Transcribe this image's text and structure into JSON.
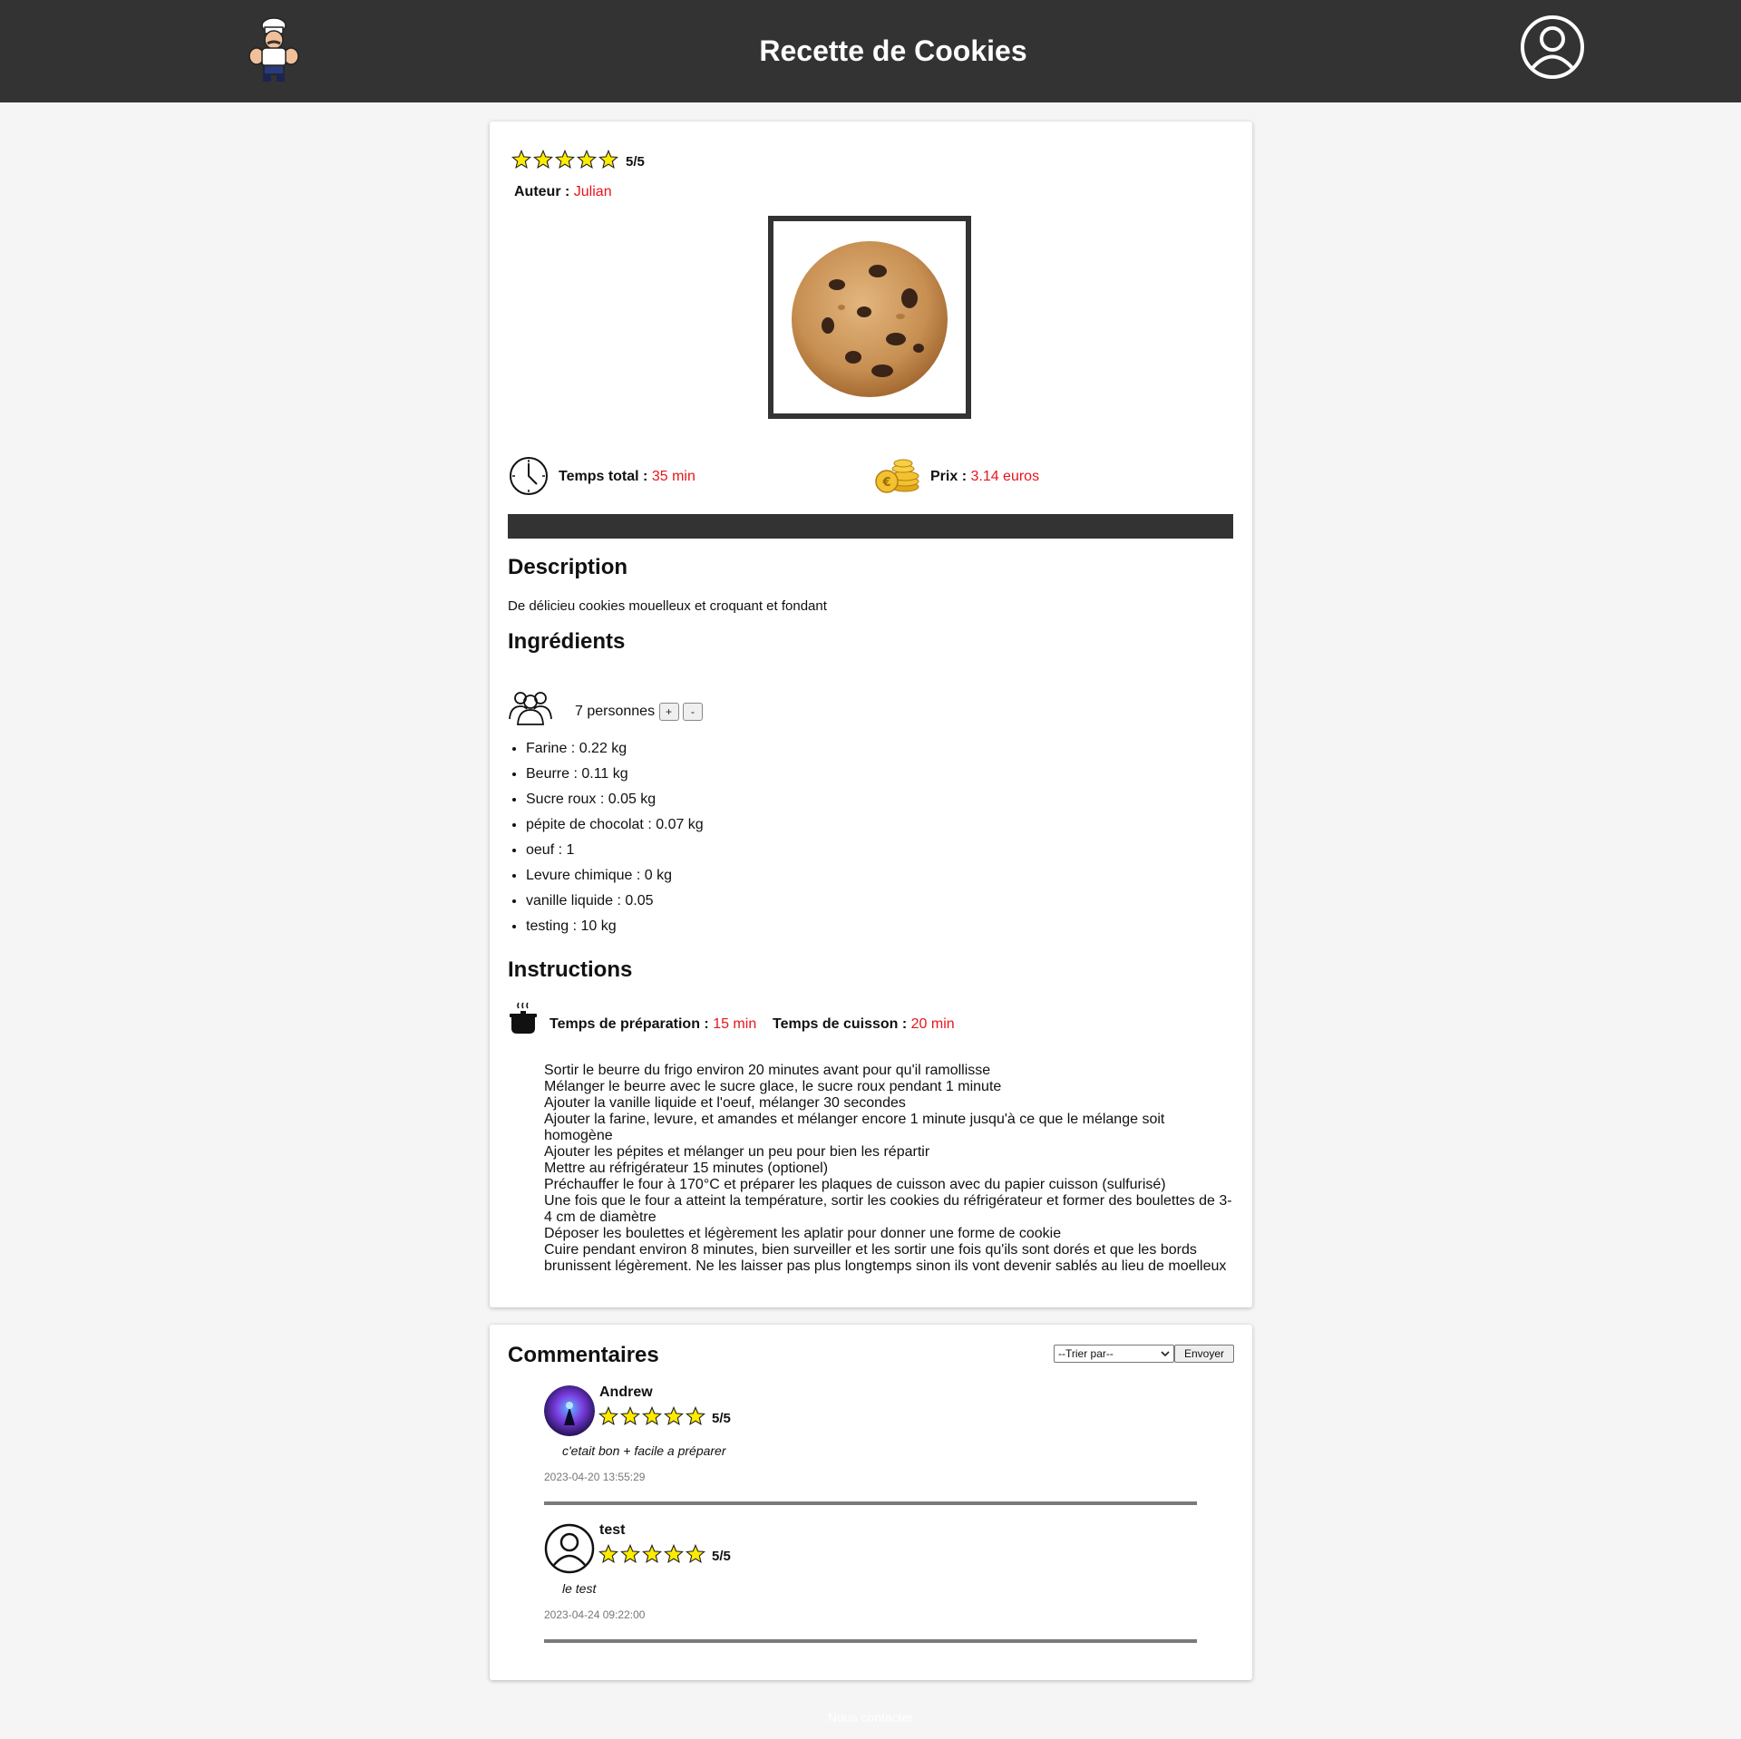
{
  "header": {
    "title": "Recette de Cookies",
    "logo_icon": "chef-logo-icon",
    "profile_icon": "user-profile-icon"
  },
  "recipe": {
    "rating": {
      "stars": 5,
      "max": 5,
      "text": "5/5"
    },
    "author_label": "Auteur :",
    "author_name": "Julian",
    "total_time_label": "Temps total :",
    "total_time_value": "35 min",
    "price_label": "Prix :",
    "price_value": "3.14 euros",
    "description_heading": "Description",
    "description_text": "De délicieu cookies mouelleux et croquant et fondant",
    "ingredients_heading": "Ingrédients",
    "servings_text": "7 personnes",
    "plus_label": "+",
    "minus_label": "-",
    "ingredients": [
      {
        "name": "Farine",
        "sep": " : ",
        "qty": "0.22 kg"
      },
      {
        "name": "Beurre",
        "sep": " : ",
        "qty": "0.11 kg"
      },
      {
        "name": "Sucre roux",
        "sep": " : ",
        "qty": "0.05 kg"
      },
      {
        "name": "pépite de chocolat",
        "sep": " : ",
        "qty": "0.07 kg"
      },
      {
        "name": "oeuf",
        "sep": " : ",
        "qty": "1"
      },
      {
        "name": "Levure chimique",
        "sep": " : ",
        "qty": "0 kg"
      },
      {
        "name": "vanille liquide",
        "sep": " : ",
        "qty": "0.05"
      },
      {
        "name": "testing",
        "sep": " : ",
        "qty": "10 kg"
      }
    ],
    "instructions_heading": "Instructions",
    "prep_label": "Temps de préparation :",
    "prep_value": "15 min",
    "cook_label": "Temps de cuisson :",
    "cook_value": "20 min",
    "steps": [
      "Sortir le beurre du frigo environ 20 minutes avant pour qu'il ramollisse",
      "Mélanger le beurre avec le sucre glace, le sucre roux pendant 1 minute",
      "Ajouter la vanille liquide et l'oeuf, mélanger 30 secondes",
      "Ajouter la farine, levure, et amandes et mélanger encore 1 minute jusqu'à ce que le mélange soit homogène",
      "Ajouter les pépites et mélanger un peu pour bien les répartir",
      "Mettre au réfrigérateur 15 minutes (optionel)",
      "Préchauffer le four à 170°C et préparer les plaques de cuisson avec du papier cuisson (sulfurisé)",
      "Une fois que le four a atteint la température, sortir les cookies du réfrigérateur et former des boulettes de 3-4 cm de diamètre",
      "Déposer les boulettes et légèrement les aplatir pour donner une forme de cookie",
      "Cuire pendant environ 8 minutes, bien surveiller et les sortir une fois qu'ils sont dorés et que les bords brunissent légèrement. Ne les laisser pas plus longtemps sinon ils vont devenir sablés au lieu de moelleux"
    ]
  },
  "comments": {
    "heading": "Commentaires",
    "sort_selected": "--Trier par--",
    "send_label": "Envoyer",
    "items": [
      {
        "author": "Andrew",
        "rating_text": "5/5",
        "stars": 5,
        "text": "c'etait bon + facile a préparer",
        "date": "2023-04-20 13:55:29"
      },
      {
        "author": "test",
        "rating_text": "5/5",
        "stars": 5,
        "text": "le test",
        "date": "2023-04-24 09:22:00"
      }
    ]
  },
  "footer": {
    "contact_label": "Nous contacter"
  },
  "colors": {
    "header_bg": "#333333",
    "accent_red": "#e8141c",
    "star_fill": "#ffeb00",
    "page_bg": "#f5f5f5"
  }
}
